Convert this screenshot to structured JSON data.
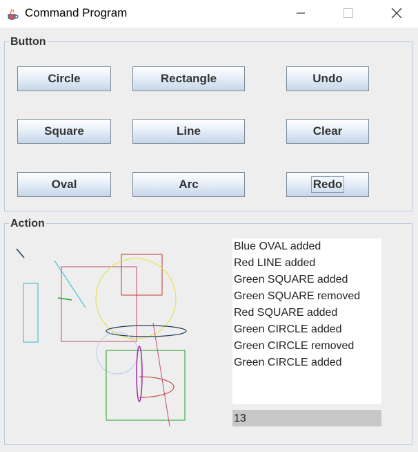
{
  "window": {
    "title": "Command Program",
    "icon": "java-cup-icon",
    "controls": [
      "minimize-icon",
      "maximize-icon",
      "close-icon"
    ]
  },
  "button_panel": {
    "legend": "Button",
    "buttons": {
      "circle": "Circle",
      "rectangle": "Rectangle",
      "undo": "Undo",
      "square": "Square",
      "line": "Line",
      "clear": "Clear",
      "oval": "Oval",
      "arc": "Arc",
      "redo": "Redo"
    }
  },
  "action_panel": {
    "legend": "Action",
    "log": [
      "Blue OVAL added",
      "Red LINE added",
      "Green SQUARE added",
      "Green SQUARE removed",
      "Red SQUARE added",
      "Green CIRCLE added",
      "Green CIRCLE removed",
      "Green CIRCLE added"
    ],
    "count": "13"
  },
  "colors": {
    "title_bar": "#ffffff",
    "panel": "#eeeeee",
    "group_border": "#b9c8dc",
    "shape_red": "#c0392b",
    "shape_green": "#22a022",
    "shape_yellow": "#e6e030",
    "shape_cyan": "#26b8d4",
    "shape_purple": "#9b2aa8",
    "shape_navy": "#1f3b5c"
  }
}
